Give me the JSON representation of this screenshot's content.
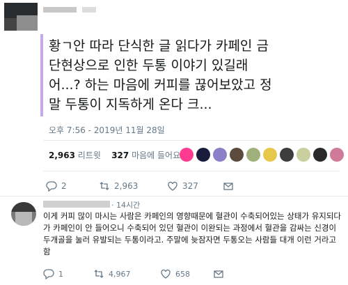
{
  "tweet": {
    "text": "황ㄱ안 따라 단식한 글 읽다가 카페인 금\n단현상으로 인한 두통 이야기 있길래\n어...? 하는 마음에 커피를 끊어보았고 정\n말 두통이 지독하게 온다 크...",
    "timestamp": "오후 7:56 - 2019년 11월 28일",
    "retweet_count": "2,963",
    "retweet_label": "리트윗",
    "like_count": "327",
    "like_label": "마음에 들어요",
    "likers": [
      "#ff3b8f",
      "#1a1c3e",
      "#8b7fc8",
      "#5b4a3e",
      "#a0b07a",
      "#e8c84a",
      "#3d3d3d",
      "#c9cf9f",
      "#2a2a2a",
      "#d07a9a"
    ],
    "actions": {
      "reply": "2",
      "retweet": "2,963",
      "like": "327"
    }
  },
  "reply": {
    "time": "· 14시간",
    "text": "이게 커피 많이 마시는 사람은 카페인의 영향때문에 혈관이 수축되어있는 상태가 유지되다가 카페인이 안 들어오니 수축되어 있던 혈관이 이완되는 과정에서 혈관을 감싸는 신경이 두개골을 눌러 유발되는 두통이라고. 주말에 늦잠자면 두통오는 사람들 대개 이런 거라고 함",
    "actions": {
      "reply": "1",
      "retweet": "4,967",
      "like": "658"
    }
  },
  "colors": {
    "accent_bar": "#c9a8e8",
    "muted": "#657786",
    "divider": "#e6ecf0"
  }
}
